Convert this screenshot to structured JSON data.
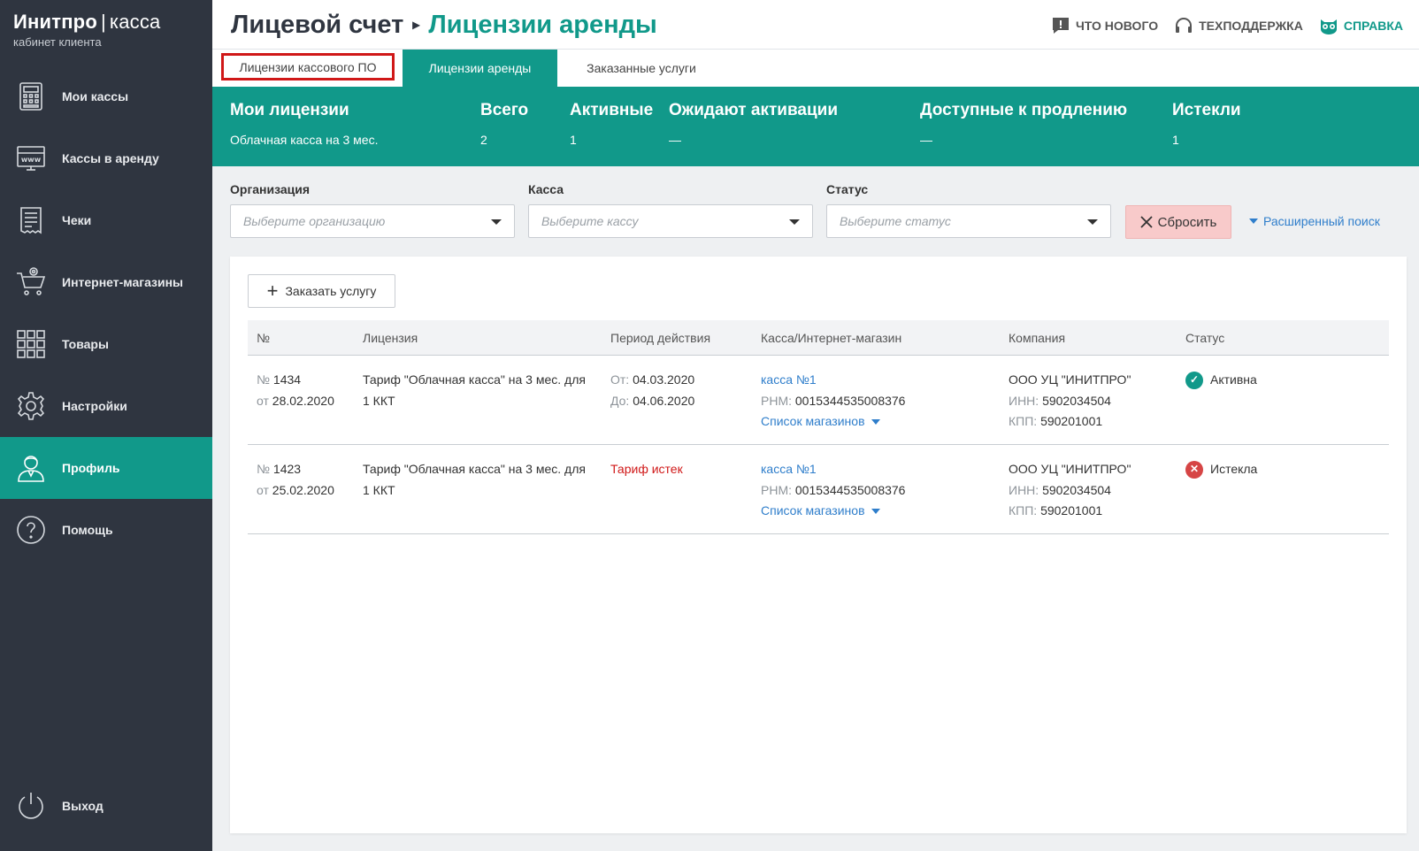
{
  "brand": {
    "name": "Инитпро",
    "separator": "|",
    "product": "касса",
    "subtitle": "кабинет клиента"
  },
  "sidebar": {
    "items": [
      {
        "label": "Мои кассы",
        "icon": "cash-register-icon"
      },
      {
        "label": "Кассы в аренду",
        "icon": "www-monitor-icon"
      },
      {
        "label": "Чеки",
        "icon": "receipt-icon"
      },
      {
        "label": "Интернет-магазины",
        "icon": "cart-icon"
      },
      {
        "label": "Товары",
        "icon": "grid-icon"
      },
      {
        "label": "Настройки",
        "icon": "gear-icon"
      },
      {
        "label": "Профиль",
        "icon": "user-icon",
        "active": true
      },
      {
        "label": "Помощь",
        "icon": "help-icon"
      }
    ],
    "logout": "Выход"
  },
  "header": {
    "crumb1": "Лицевой счет",
    "crumb2": "Лицензии аренды",
    "links": {
      "news": "ЧТО НОВОГО",
      "support": "ТЕХПОДДЕРЖКА",
      "help": "СПРАВКА"
    }
  },
  "tabs": [
    "Лицензии кассового ПО",
    "Лицензии аренды",
    "Заказанные услуги"
  ],
  "stats": {
    "my_licenses": {
      "label": "Мои лицензии",
      "value": "Облачная касса на 3 мес."
    },
    "total": {
      "label": "Всего",
      "value": "2"
    },
    "active": {
      "label": "Активные",
      "value": "1"
    },
    "pending": {
      "label": "Ожидают активации",
      "value": "—"
    },
    "renewable": {
      "label": "Доступные к продлению",
      "value": "—"
    },
    "expired": {
      "label": "Истекли",
      "value": "1"
    }
  },
  "filters": {
    "org": {
      "label": "Организация",
      "placeholder": "Выберите организацию"
    },
    "kassa": {
      "label": "Касса",
      "placeholder": "Выберите кассу"
    },
    "status": {
      "label": "Статус",
      "placeholder": "Выберите статус"
    },
    "reset": "Сбросить",
    "advanced": "Расширенный поиск"
  },
  "order_button": "Заказать услугу",
  "table": {
    "headers": [
      "№",
      "Лицензия",
      "Период действия",
      "Касса/Интернет-магазин",
      "Компания",
      "Статус"
    ],
    "rows": [
      {
        "num_prefix": "№",
        "num": "1434",
        "date_prefix": "от",
        "date": "28.02.2020",
        "license_line1": "Тариф \"Облачная касса\" на 3 мес. для",
        "license_line2": "1 ККТ",
        "from_label": "От:",
        "from": "04.03.2020",
        "to_label": "До:",
        "to": "04.06.2020",
        "kassa": "касса №1",
        "rnm_label": "РНМ:",
        "rnm": "0015344535008376",
        "shops": "Список магазинов",
        "company": "ООО УЦ \"ИНИТПРО\"",
        "inn_label": "ИНН:",
        "inn": "5902034504",
        "kpp_label": "КПП:",
        "kpp": "590201001",
        "status": "Активна"
      },
      {
        "num_prefix": "№",
        "num": "1423",
        "date_prefix": "от",
        "date": "25.02.2020",
        "license_line1": "Тариф \"Облачная касса\" на 3 мес. для",
        "license_line2": "1 ККТ",
        "period_expired": "Тариф истек",
        "kassa": "касса №1",
        "rnm_label": "РНМ:",
        "rnm": "0015344535008376",
        "shops": "Список магазинов",
        "company": "ООО УЦ \"ИНИТПРО\"",
        "inn_label": "ИНН:",
        "inn": "5902034504",
        "kpp_label": "КПП:",
        "kpp": "590201001",
        "status": "Истекла"
      }
    ]
  },
  "colors": {
    "accent": "#11998a",
    "sidebar": "#2f3540",
    "link": "#2f7ecb",
    "danger": "#d01818"
  }
}
